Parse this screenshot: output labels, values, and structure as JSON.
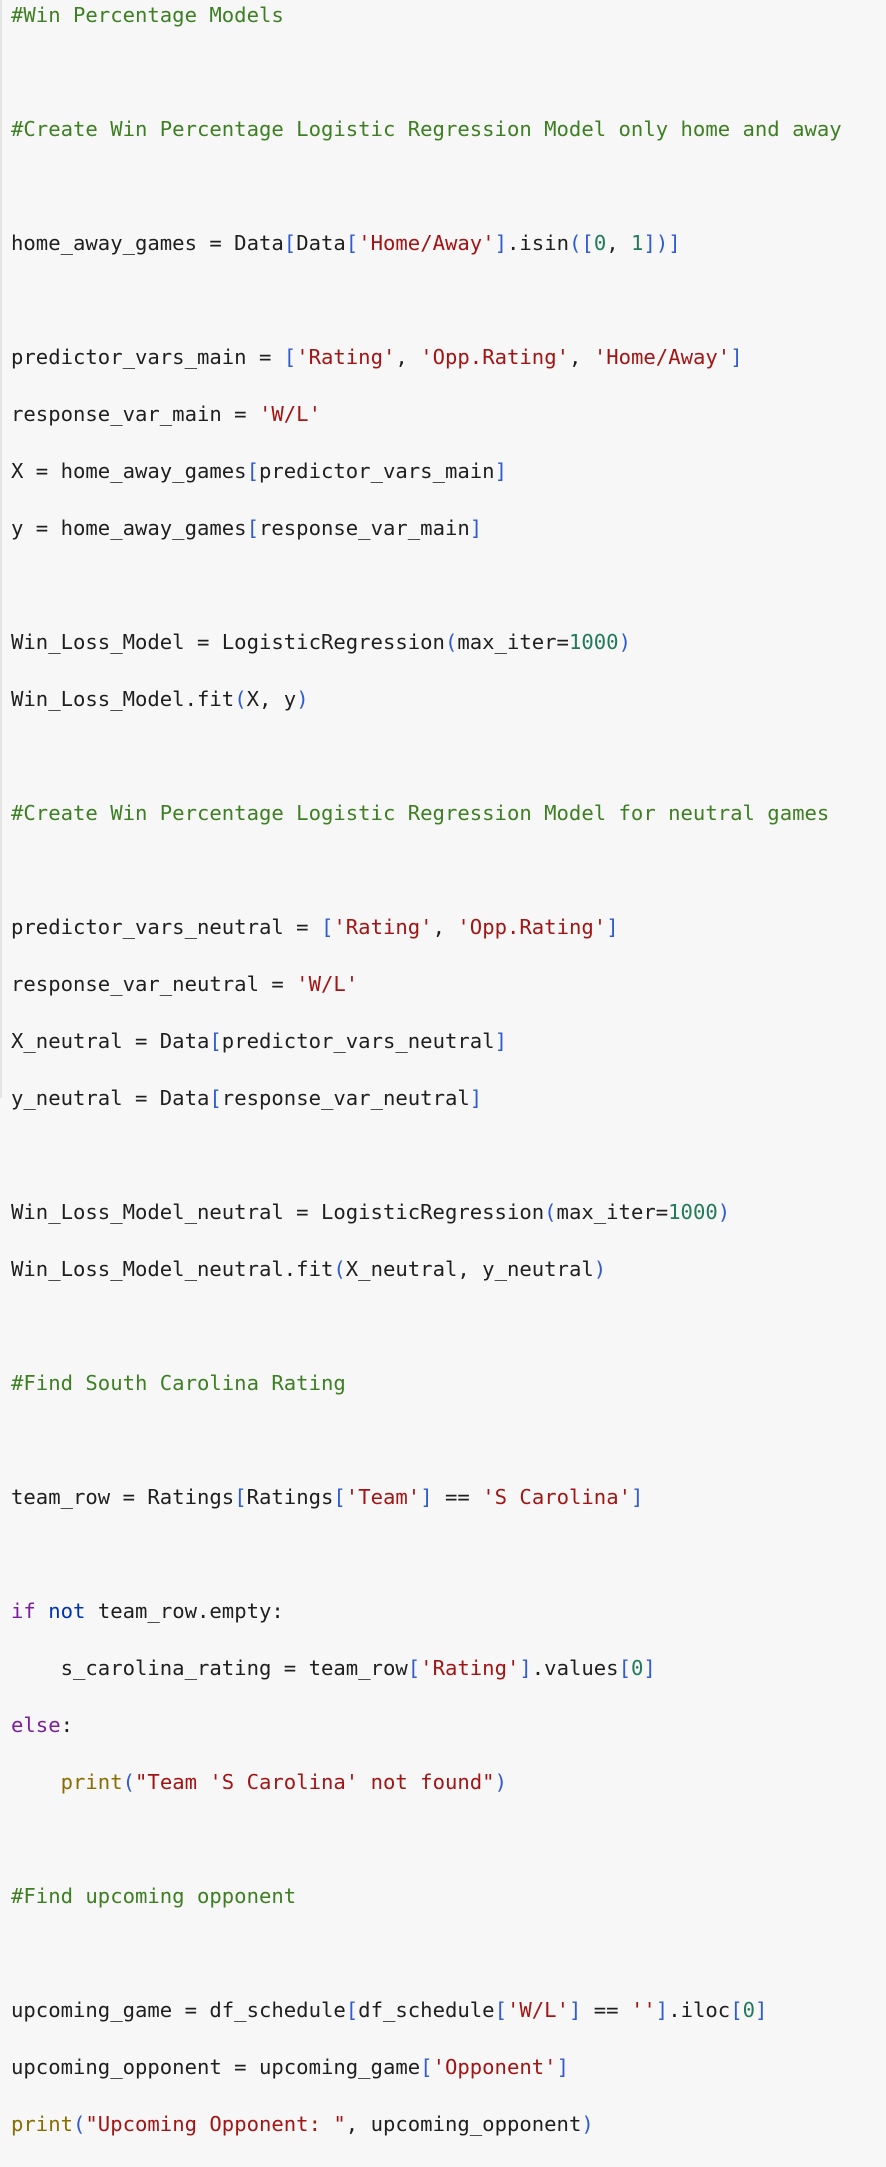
{
  "code_lines": [
    "#Win Percentage Models",
    "",
    "#Create Win Percentage Logistic Regression Model only home and away",
    "",
    "home_away_games = Data[Data['Home/Away'].isin([0, 1])]",
    "",
    "predictor_vars_main = ['Rating', 'Opp.Rating', 'Home/Away']",
    "response_var_main = 'W/L'",
    "X = home_away_games[predictor_vars_main]",
    "y = home_away_games[response_var_main]",
    "",
    "Win_Loss_Model = LogisticRegression(max_iter=1000)",
    "Win_Loss_Model.fit(X, y)",
    "",
    "#Create Win Percentage Logistic Regression Model for neutral games",
    "",
    "predictor_vars_neutral = ['Rating', 'Opp.Rating']",
    "response_var_neutral = 'W/L'",
    "X_neutral = Data[predictor_vars_neutral]",
    "y_neutral = Data[response_var_neutral]",
    "",
    "Win_Loss_Model_neutral = LogisticRegression(max_iter=1000)",
    "Win_Loss_Model_neutral.fit(X_neutral, y_neutral)",
    "",
    "#Find South Carolina Rating",
    "",
    "team_row = Ratings[Ratings['Team'] == 'S Carolina']",
    "",
    "if not team_row.empty:",
    "    s_carolina_rating = team_row['Rating'].values[0]",
    "else:",
    "    print(\"Team 'S Carolina' not found\")",
    "",
    "#Find upcoming opponent",
    "",
    "upcoming_game = df_schedule[df_schedule['W/L'] == ''].iloc[0]",
    "upcoming_opponent = upcoming_game['Opponent']",
    "print(\"Upcoming Opponent: \", upcoming_opponent)"
  ],
  "colors": {
    "background": "#f7f7f7",
    "comment": "#3d7f22",
    "string": "#a31515",
    "number": "#237a5a",
    "keyword": "#7a1fa2",
    "keyword_not": "#0033b3",
    "builtin": "#8a6d00",
    "bracket": "#2f5bd3",
    "text": "#1f1f1f"
  }
}
